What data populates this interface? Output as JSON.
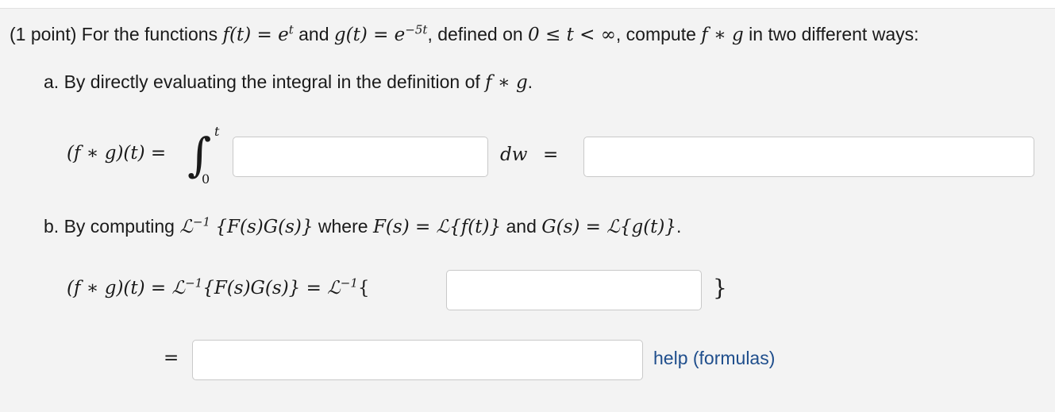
{
  "problem": {
    "points": "(1 point)",
    "intro_text": "For the functions",
    "f_def": "f(t) = e",
    "f_exp": "t",
    "and_text": "and",
    "g_def": "g(t) = e",
    "g_exp": "−5t",
    "domain_text": ", defined on",
    "interval": "0 ≤ t < ∞",
    "compute_text": ", compute",
    "conv": "f ∗ g",
    "ways_text": "in two different ways:"
  },
  "part_a": {
    "label": "a. By directly evaluating the integral in the definition of",
    "conv": "f ∗ g",
    "period": ".",
    "lhs": "(f ∗ g)(t) =",
    "upper_limit": "t",
    "lower_limit": "0",
    "dw": "dw",
    "equals": "=",
    "integrand_value": "",
    "result_value": ""
  },
  "part_b": {
    "label_prefix": "b. By computing",
    "inv_laplace": "ℒ",
    "inv_exp": "−1",
    "fg_brace": "{F(s)G(s)}",
    "where_text": "where",
    "F_def": "F(s) = ℒ{f(t)}",
    "and_text": "and",
    "G_def": "G(s) = ℒ{g(t)}",
    "period": ".",
    "eq1": "(f ∗ g)(t) = ℒ",
    "eq1_exp": "−1",
    "eq1_rest": "{F(s)G(s)} = ℒ",
    "eq1_exp2": "−1",
    "open_brace": "{",
    "close_brace": "}",
    "equals2": "=",
    "inner_value": "",
    "final_value": ""
  },
  "help_link": "help (formulas)"
}
